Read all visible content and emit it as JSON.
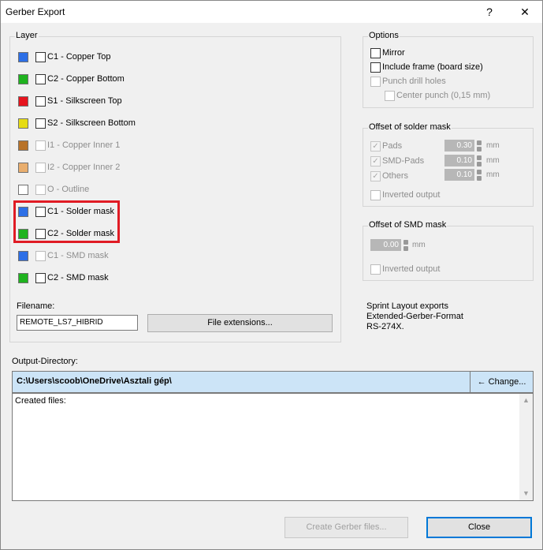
{
  "window": {
    "title": "Gerber Export",
    "help_glyph": "?",
    "close_glyph": "✕"
  },
  "layer_group": {
    "label": "Layer",
    "layers": [
      {
        "label": "C1 - Copper Top",
        "color": "#2d6fe6",
        "enabled": true
      },
      {
        "label": "C2 - Copper Bottom",
        "color": "#1fb31f",
        "enabled": true
      },
      {
        "label": "S1 - Silkscreen Top",
        "color": "#e6141e",
        "enabled": true
      },
      {
        "label": "S2 - Silkscreen Bottom",
        "color": "#e6dc14",
        "enabled": true
      },
      {
        "label": "I1 - Copper Inner 1",
        "color": "#b8732a",
        "enabled": false
      },
      {
        "label": "I2 - Copper Inner 2",
        "color": "#e9ae6e",
        "enabled": false
      },
      {
        "label": "O - Outline",
        "color": "#ffffff",
        "enabled": false
      },
      {
        "label": "C1 - Solder mask",
        "color": "#2d6fe6",
        "enabled": true
      },
      {
        "label": "C2 - Solder mask",
        "color": "#1fb31f",
        "enabled": true
      },
      {
        "label": "C1 - SMD mask",
        "color": "#2d6fe6",
        "enabled": false
      },
      {
        "label": "C2 - SMD mask",
        "color": "#1fb31f",
        "enabled": true
      }
    ],
    "filename_label": "Filename:",
    "filename_value": "REMOTE_LS7_HIBRID",
    "file_extensions_button": "File extensions..."
  },
  "options_group": {
    "label": "Options",
    "mirror": "Mirror",
    "include_frame": "Include frame (board size)",
    "punch_drill": "Punch drill holes",
    "center_punch": "Center punch (0,15 mm)"
  },
  "solder_mask_group": {
    "label": "Offset of solder mask",
    "pads_label": "Pads",
    "pads_value": "0.30",
    "smd_pads_label": "SMD-Pads",
    "smd_pads_value": "0.10",
    "others_label": "Others",
    "others_value": "0.10",
    "unit": "mm",
    "inverted_output": "Inverted output",
    "check_glyph": "✓"
  },
  "smd_mask_group": {
    "label": "Offset of SMD mask",
    "value": "0.00",
    "unit": "mm",
    "inverted_output": "Inverted output"
  },
  "info": {
    "line1": "Sprint Layout exports",
    "line2": "Extended-Gerber-Format",
    "line3": "RS-274X."
  },
  "output": {
    "label": "Output-Directory:",
    "path": "C:\\Users\\scoob\\OneDrive\\Asztali gép\\",
    "change_button": "Change...",
    "change_icon": "←",
    "created_files_label": "Created files:",
    "scroll_up": "▲",
    "scroll_down": "▼"
  },
  "buttons": {
    "create": "Create Gerber files...",
    "close": "Close"
  }
}
